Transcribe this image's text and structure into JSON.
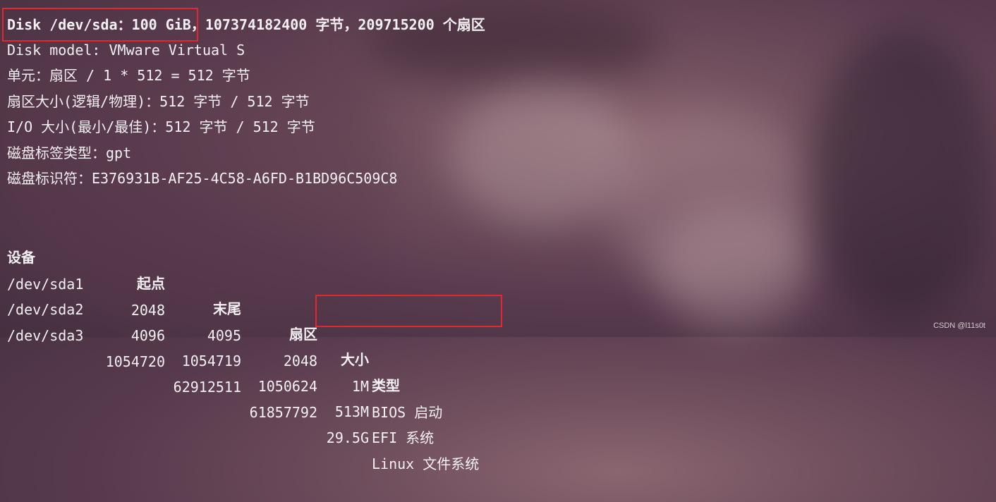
{
  "disk": {
    "summary_highlight": "Disk /dev/sda：100 GiB",
    "summary_rest": "，107374182400 字节，209715200 个扇区",
    "model": "Disk model: VMware Virtual S",
    "units": "单元：扇区 / 1 * 512 = 512 字节",
    "sector_size": "扇区大小(逻辑/物理)：512 字节 / 512 字节",
    "io_size": "I/O 大小(最小/最佳)：512 字节 / 512 字节",
    "label_type": "磁盘标签类型：gpt",
    "identifier": "磁盘标识符：E376931B-AF25-4C58-A6FD-B1BD96C509C8"
  },
  "table": {
    "headers": {
      "device": "设备",
      "start": "起点",
      "end": "末尾",
      "sectors": "扇区",
      "size": "大小",
      "type": "类型"
    },
    "rows": [
      {
        "device": "/dev/sda1",
        "start": "2048",
        "end": "4095",
        "sectors": "2048",
        "size": "1M",
        "type": "BIOS 启动"
      },
      {
        "device": "/dev/sda2",
        "start": "4096",
        "end": "1054719",
        "sectors": "1050624",
        "size": "513M",
        "type": "EFI 系统"
      },
      {
        "device": "/dev/sda3",
        "start": "1054720",
        "end": "62912511",
        "sectors": "61857792",
        "size": "29.5G",
        "type": "Linux 文件系统"
      }
    ]
  },
  "watermark": "CSDN @l11s0t",
  "colors": {
    "highlight_border": "#e0282e",
    "text": "#f3f0f2"
  }
}
